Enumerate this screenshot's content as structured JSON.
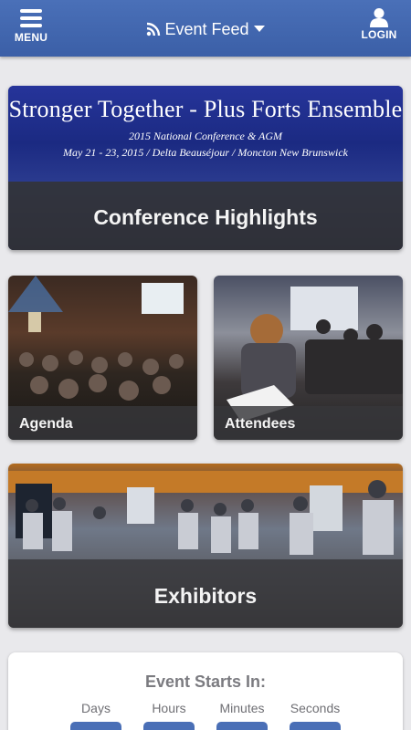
{
  "header": {
    "menu_label": "MENU",
    "feed_title": "Event Feed",
    "login_label": "LOGIN"
  },
  "hero": {
    "banner_line1": "Stronger Together - Plus Forts Ensemble",
    "banner_line2": "2015 National Conference & AGM",
    "banner_line3": "May 21 - 23, 2015 / Delta Beauséjour / Moncton New Brunswick",
    "caption": "Conference Highlights"
  },
  "tiles": {
    "agenda": "Agenda",
    "attendees": "Attendees",
    "exhibitors": "Exhibitors"
  },
  "countdown": {
    "title": "Event Starts In:",
    "units": [
      "Days",
      "Hours",
      "Minutes",
      "Seconds"
    ]
  },
  "colors": {
    "header": "#3b5fa7",
    "accent": "#4a6fb6",
    "background": "#e9e9ec"
  }
}
